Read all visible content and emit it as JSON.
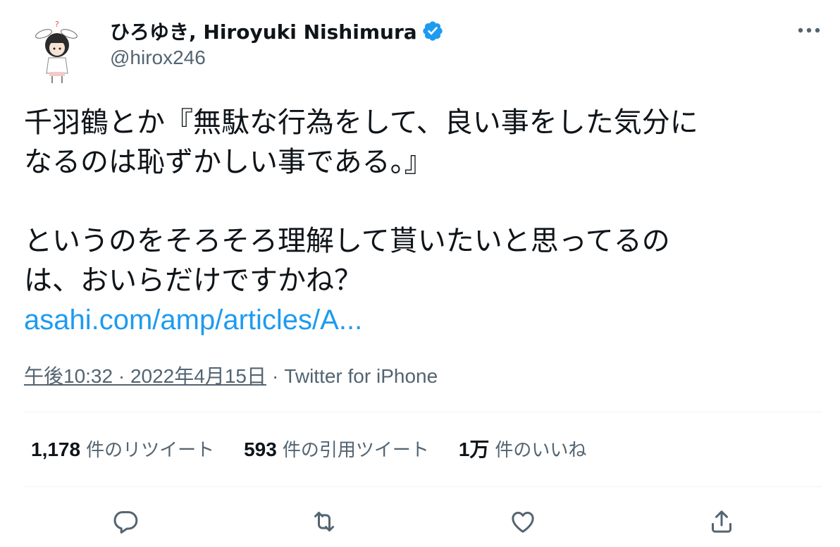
{
  "user": {
    "display_name": "ひろゆき, Hiroyuki Nishimura",
    "handle": "@hirox246",
    "verified": true,
    "avatar": "avatar-character-icon"
  },
  "tweet": {
    "lines": [
      "千羽鶴とか『無駄な行為をして、良い事をした気分に",
      "なるのは恥ずかしい事である。』",
      "",
      "というのをそろそろ理解して貰いたいと思ってるの",
      "は、おいらだけですかね？"
    ],
    "link_text": "asahi.com/amp/articles/A..."
  },
  "meta": {
    "timestamp": "午後10:32 · 2022年4月15日",
    "separator": "·",
    "source": "Twitter for iPhone"
  },
  "stats": {
    "retweets": {
      "count": "1,178",
      "label": "件のリツイート"
    },
    "quotes": {
      "count": "593",
      "label": "件の引用ツイート"
    },
    "likes": {
      "count": "1万",
      "label": "件のいいね"
    }
  },
  "actions": [
    "reply-icon",
    "retweet-icon",
    "like-icon",
    "share-icon"
  ],
  "colors": {
    "text": "#0f1419",
    "secondary": "#536471",
    "link": "#1d9bf0",
    "verified": "#1d9bf0",
    "divider": "#eff3f4"
  }
}
